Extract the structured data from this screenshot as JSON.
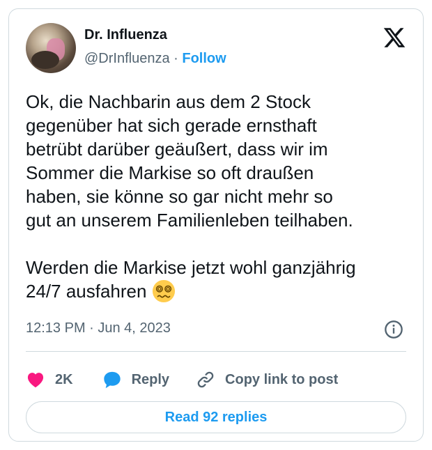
{
  "author": {
    "name": "Dr. Influenza",
    "handle": "@DrInfluenza",
    "separator": "·",
    "follow_label": "Follow"
  },
  "tweet": {
    "text": "Ok, die Nachbarin aus dem 2 Stock\ngegenüber hat sich gerade ernsthaft\nbetrübt darüber geäußert, dass wir im\nSommer die Markise so oft draußen\nhaben, sie könne so gar nicht mehr so\ngut an unserem Familienleben teilhaben.\n\nWerden die Markise jetzt wohl ganzjährig\n24/7 ausfahren",
    "emoji": "woozy-face-icon",
    "time": "12:13 PM · Jun 4, 2023"
  },
  "actions": {
    "likes": "2K",
    "reply_label": "Reply",
    "copy_label": "Copy link to post"
  },
  "read_replies_label": "Read 92 replies",
  "colors": {
    "accent": "#1d9bf0",
    "like": "#f91880",
    "text": "#0f1419",
    "muted": "#536471",
    "border": "#cfd9de"
  }
}
